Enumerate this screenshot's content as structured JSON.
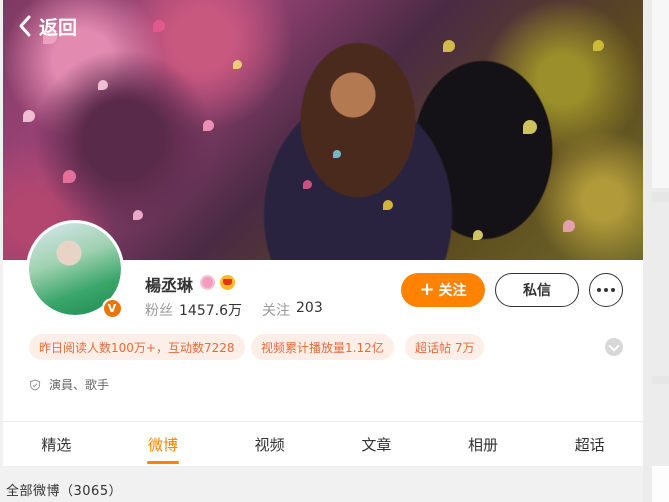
{
  "header": {
    "back_label": "返回"
  },
  "profile": {
    "name": "楊丞琳",
    "fans_label": "粉丝",
    "fans_value": "1457.6万",
    "following_label": "关注",
    "following_value": "203",
    "verified_mark": "V",
    "description": "演員、歌手"
  },
  "actions": {
    "follow_label": "关注",
    "message_label": "私信"
  },
  "tags": [
    "昨日阅读人数100万+，互动数7228",
    "视频累计播放量1.12亿",
    "超话帖 7万"
  ],
  "tabs": [
    {
      "label": "精选",
      "active": false
    },
    {
      "label": "微博",
      "active": true
    },
    {
      "label": "视频",
      "active": false
    },
    {
      "label": "文章",
      "active": false
    },
    {
      "label": "相册",
      "active": false
    },
    {
      "label": "超话",
      "active": false
    }
  ],
  "footer": {
    "all_posts": "全部微博（3065）"
  },
  "colors": {
    "accent": "#ff8200",
    "tag_bg": "#fdefe8",
    "tag_text": "#e86b3a"
  }
}
